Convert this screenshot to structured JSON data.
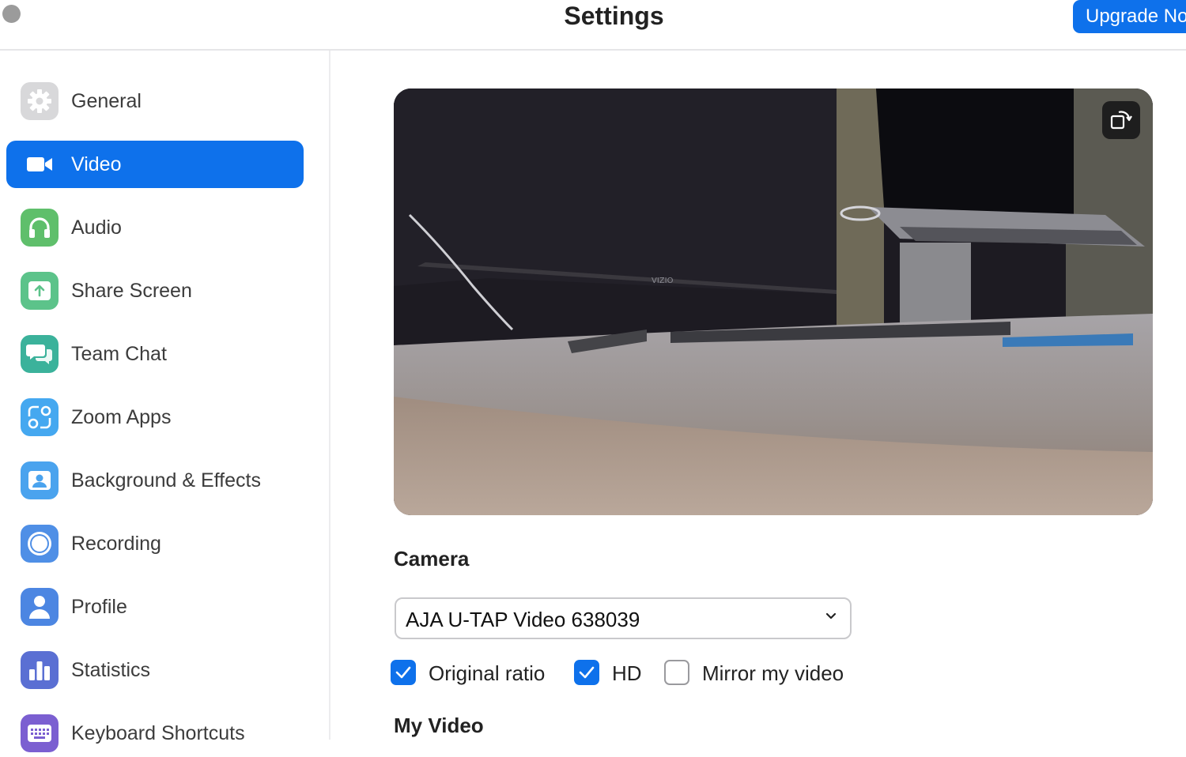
{
  "window": {
    "title": "Settings",
    "upgrade_label": "Upgrade Now"
  },
  "sidebar": {
    "items": [
      {
        "label": "General",
        "icon": "gear-icon",
        "color": "#d8d8da"
      },
      {
        "label": "Video",
        "icon": "video-camera-icon",
        "color": "#0e71eb",
        "active": true
      },
      {
        "label": "Audio",
        "icon": "headphones-icon",
        "color": "#5fbf6b"
      },
      {
        "label": "Share Screen",
        "icon": "share-screen-icon",
        "color": "#5cc38a"
      },
      {
        "label": "Team Chat",
        "icon": "chat-bubbles-icon",
        "color": "#3bb29b"
      },
      {
        "label": "Zoom Apps",
        "icon": "apps-icon",
        "color": "#45a8f0"
      },
      {
        "label": "Background & Effects",
        "icon": "person-portrait-icon",
        "color": "#4aa3ee"
      },
      {
        "label": "Recording",
        "icon": "record-icon",
        "color": "#4f8fe6"
      },
      {
        "label": "Profile",
        "icon": "profile-icon",
        "color": "#4c86e2"
      },
      {
        "label": "Statistics",
        "icon": "bar-chart-icon",
        "color": "#5a6fd3"
      },
      {
        "label": "Keyboard Shortcuts",
        "icon": "keyboard-icon",
        "color": "#7b5fd1"
      }
    ]
  },
  "main": {
    "camera_heading": "Camera",
    "camera_value": "AJA U-TAP Video 638039",
    "options": [
      {
        "label": "Original ratio",
        "checked": true
      },
      {
        "label": "HD",
        "checked": true
      },
      {
        "label": "Mirror my video",
        "checked": false
      }
    ],
    "my_video_heading": "My Video"
  }
}
